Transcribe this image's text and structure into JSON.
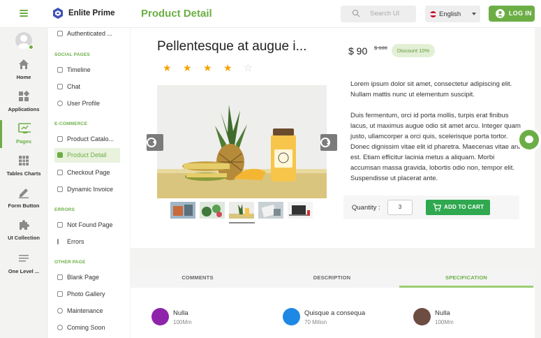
{
  "app": {
    "brand": "Enlite Prime",
    "page_title": "Product Detail"
  },
  "header": {
    "search_placeholder": "Search UI",
    "language": "English",
    "login_label": "LOG IN"
  },
  "rail": [
    {
      "label": "Home",
      "icon": "home-icon"
    },
    {
      "label": "Applications",
      "icon": "apps-icon"
    },
    {
      "label": "Pages",
      "icon": "pages-icon",
      "active": true
    },
    {
      "label": "Tables Charts",
      "icon": "table-icon"
    },
    {
      "label": "Form Button",
      "icon": "pencil-icon"
    },
    {
      "label": "UI Collection",
      "icon": "puzzle-icon"
    },
    {
      "label": "One Level ...",
      "icon": "list-icon"
    }
  ],
  "subnav": {
    "top_item": "Authenticated ...",
    "social_head": "SOCIAL PAGES",
    "social": [
      "Timeline",
      "Chat",
      "User Profile"
    ],
    "ecommerce_head": "E-COMMERCE",
    "ecommerce": [
      "Product Catalo...",
      "Product Detail",
      "Checkout Page",
      "Dynamic Invoice"
    ],
    "errors_head": "ERRORS",
    "errors": [
      "Not Found Page",
      "Errors"
    ],
    "other_head": "OTHER PAGE",
    "other": [
      "Blank Page",
      "Photo Gallery",
      "Maintenance",
      "Coming Soon"
    ]
  },
  "product": {
    "title": "Pellentesque at augue i...",
    "rating": 4,
    "max_rating": 5,
    "price": "$ 90",
    "old_price": "$ 100",
    "discount": "Discount 10%",
    "desc1": "Lorem ipsum dolor sit amet, consectetur adipiscing elit. Nullam mattis nunc ut elementum suscipit.",
    "desc2": "Duis fermentum, orci id porta mollis, turpis erat finibus lacus, ut maximus augue odio sit amet arcu. Integer quam justo, ullamcorper a orci quis, scelerisque porta tortor. Donec dignissim vitae elit id pharetra. Maecenas vitae ante est. Etiam efficitur lacinia metus a aliquam. Morbi accumsan massa gravida, lobortis odio non, tempor elit. Suspendisse ut placerat ante.",
    "quantity_label": "Quantity :",
    "quantity": "3",
    "add_to_cart": "ADD TO CART"
  },
  "tabs": [
    "COMMENTS",
    "DESCRIPTION",
    "SPECIFICATION"
  ],
  "specs": [
    {
      "name": "Nulla",
      "value": "100Mm",
      "color": "#8e24aa"
    },
    {
      "name": "Quisque a consequa",
      "value": "70 Milion",
      "color": "#1e88e5"
    },
    {
      "name": "Nulla",
      "value": "100Mm",
      "color": "#6d4c41"
    }
  ],
  "colors": {
    "accent": "#6cae45",
    "cart_button": "#2fa84f"
  }
}
